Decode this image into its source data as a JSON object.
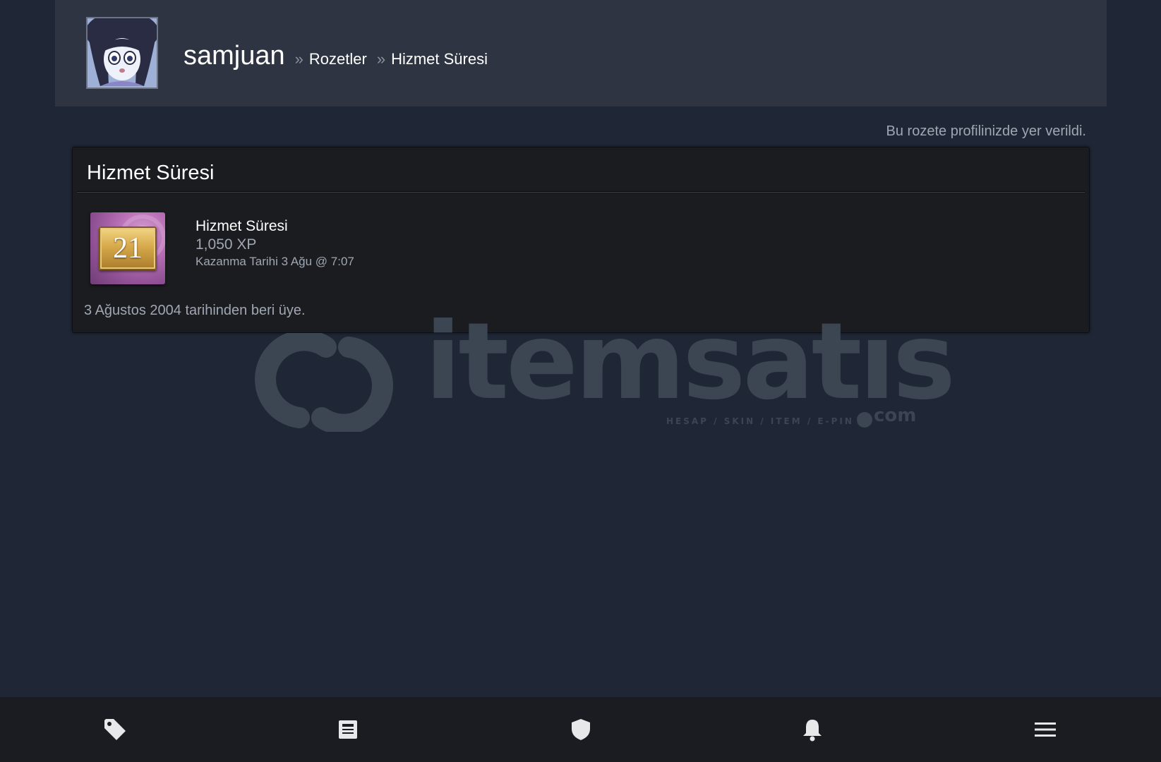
{
  "header": {
    "username": "samjuan",
    "separator": "»",
    "breadcrumb_badges": "Rozetler",
    "breadcrumb_current": "Hizmet Süresi"
  },
  "status_note": "Bu rozete profilinizde yer verildi.",
  "badge_panel": {
    "title": "Hizmet Süresi",
    "badge": {
      "level": "21",
      "name": "Hizmet Süresi",
      "xp": "1,050 XP",
      "earned": "Kazanma Tarihi 3 Ağu @ 7:07"
    },
    "description": "3 Ağustos 2004 tarihinden beri üye."
  },
  "watermark": {
    "text": "itemsatıs",
    "tagline": "HESAP / SKIN / ITEM / E-PIN",
    "suffix": "com"
  },
  "bottom_nav": {
    "items": [
      {
        "icon": "tag-icon"
      },
      {
        "icon": "news-icon"
      },
      {
        "icon": "shield-icon"
      },
      {
        "icon": "bell-icon"
      },
      {
        "icon": "menu-icon"
      }
    ]
  },
  "colors": {
    "page_background": "#1f2737",
    "header_background": "#2e3442",
    "panel_background": "#1b1c20",
    "muted_text": "#9fa7b3",
    "nav_background": "#1a1c21",
    "badge_frame": "#b86fb5",
    "badge_plate": "#d8aa4c"
  }
}
